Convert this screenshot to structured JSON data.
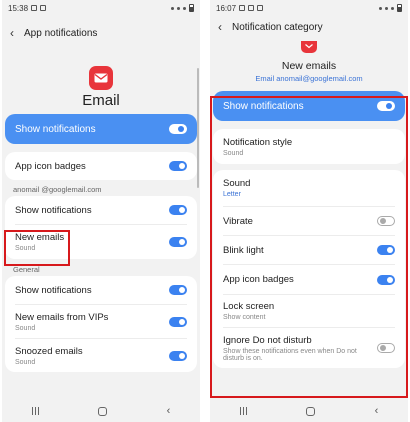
{
  "left": {
    "status": {
      "time": "15:38"
    },
    "title": "App notifications",
    "app_name": "Email",
    "show_notifications": {
      "label": "Show notifications",
      "on": true
    },
    "app_icon_badges": {
      "label": "App icon badges",
      "on": true
    },
    "account_label": "anomail @googlemail.com",
    "account_rows": [
      {
        "label": "Show notifications",
        "sub": "",
        "on": true
      },
      {
        "label": "New emails",
        "sub": "Sound",
        "on": true
      }
    ],
    "general_label": "General",
    "general_rows": [
      {
        "label": "Show notifications",
        "sub": "",
        "on": true
      },
      {
        "label": "New emails from VIPs",
        "sub": "Sound",
        "on": true
      },
      {
        "label": "Snoozed emails",
        "sub": "Sound",
        "on": true
      }
    ]
  },
  "right": {
    "status": {
      "time": "16:07"
    },
    "title": "Notification category",
    "category_name": "New emails",
    "account_line": "Email anomail@googlemail.com",
    "show_notifications": {
      "label": "Show notifications",
      "on": true
    },
    "rows": [
      {
        "label": "Notification style",
        "sub": "Sound",
        "toggle": "none"
      },
      {
        "label": "Sound",
        "sub": "Letter",
        "toggle": "none"
      },
      {
        "label": "Vibrate",
        "sub": "",
        "toggle": "off"
      },
      {
        "label": "Blink light",
        "sub": "",
        "toggle": "on"
      },
      {
        "label": "App icon badges",
        "sub": "",
        "toggle": "on"
      },
      {
        "label": "Lock screen",
        "sub": "Show content",
        "toggle": "none"
      },
      {
        "label": "Ignore Do not disturb",
        "sub": "Show these notifications even when Do not disturb is on.",
        "toggle": "off"
      }
    ]
  },
  "colors": {
    "accent": "#4a90f2",
    "toggle_on": "#3b82f0",
    "highlight": "#d7191c",
    "brand": "#e8353b"
  },
  "icons": [
    "back-arrow-icon",
    "email-app-icon",
    "recents-icon",
    "home-icon",
    "nav-back-icon"
  ]
}
